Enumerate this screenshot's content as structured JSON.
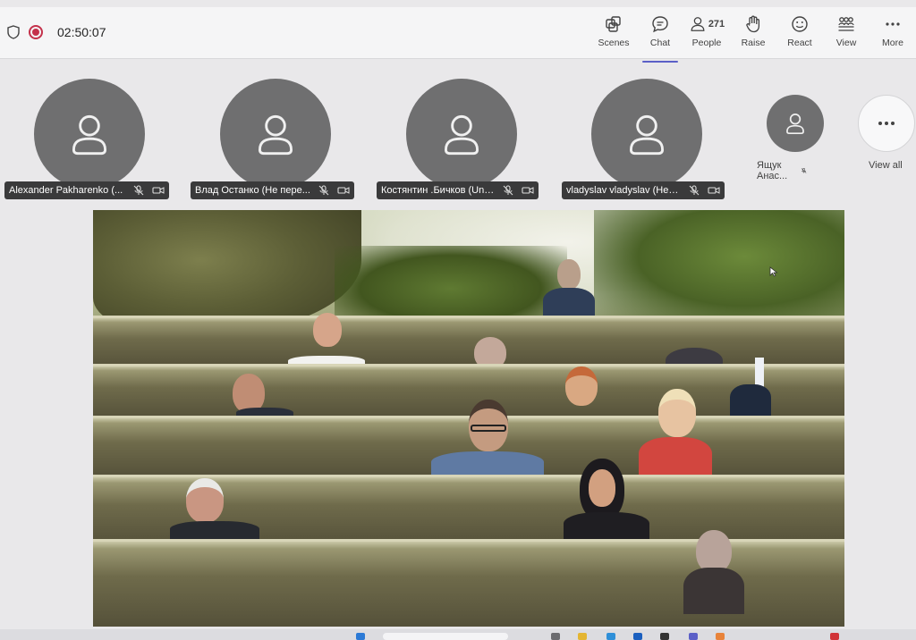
{
  "meeting": {
    "timer": "02:50:07"
  },
  "toolbar": {
    "buttons": [
      {
        "label": "Scenes",
        "icon": "scenes-icon"
      },
      {
        "label": "Chat",
        "icon": "chat-icon",
        "active": true
      },
      {
        "label": "People",
        "icon": "people-icon",
        "count": "271"
      },
      {
        "label": "Raise",
        "icon": "raise-hand-icon"
      },
      {
        "label": "React",
        "icon": "react-icon"
      },
      {
        "label": "View",
        "icon": "view-icon"
      },
      {
        "label": "More",
        "icon": "more-icon"
      }
    ]
  },
  "participants": [
    {
      "name": "Alexander Pakharenko (..."
    },
    {
      "name": "Влад Останко (Не пере..."
    },
    {
      "name": "Костянтин .Бичков (Unv..."
    },
    {
      "name": "vladyslav vladyslav (Не п..."
    },
    {
      "name": "Ящук Анас..."
    }
  ],
  "view_all": {
    "label": "View all",
    "icon": "more-icon"
  },
  "colors": {
    "accent": "#5b5fc7",
    "record": "#c4314b",
    "avatar_bg": "#6f6f70",
    "nameplate_bg": "#3a3a3b"
  }
}
